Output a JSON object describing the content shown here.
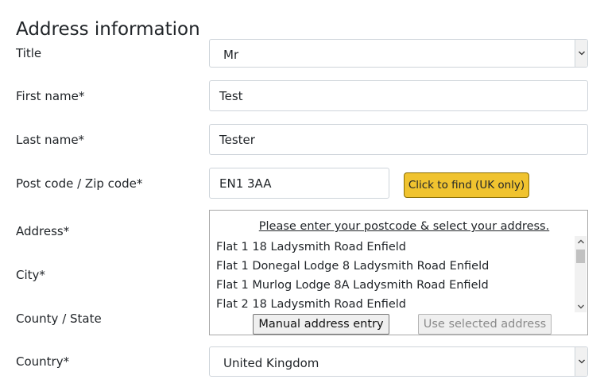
{
  "section": {
    "title": "Address information"
  },
  "labels": {
    "title": "Title",
    "first_name": "First name*",
    "last_name": "Last name*",
    "postcode": "Post code / Zip code*",
    "address": "Address*",
    "city": "City*",
    "county": "County / State",
    "country": "Country*"
  },
  "fields": {
    "title_value": "Mr",
    "first_name_value": "Test",
    "last_name_value": "Tester",
    "postcode_value": "EN1 3AA",
    "country_value": "United Kingdom"
  },
  "buttons": {
    "find": "Click to find (UK only)",
    "manual": "Manual address entry",
    "use_selected": "Use selected address"
  },
  "address_lookup": {
    "hint": "Please enter your postcode & select your address.",
    "results": [
      "Flat 1 18 Ladysmith Road Enfield",
      "Flat 1 Donegal Lodge 8 Ladysmith Road Enfield",
      "Flat 1 Murlog Lodge 8A Ladysmith Road Enfield",
      "Flat 2 18 Ladysmith Road Enfield"
    ]
  },
  "colors": {
    "find_button": "#f0c32f",
    "text": "#212529",
    "border": "#ced4da"
  },
  "icons": {
    "select_arrow": "chevron-down-icon",
    "scroll_up": "chevron-up-icon",
    "scroll_down": "chevron-down-icon"
  }
}
